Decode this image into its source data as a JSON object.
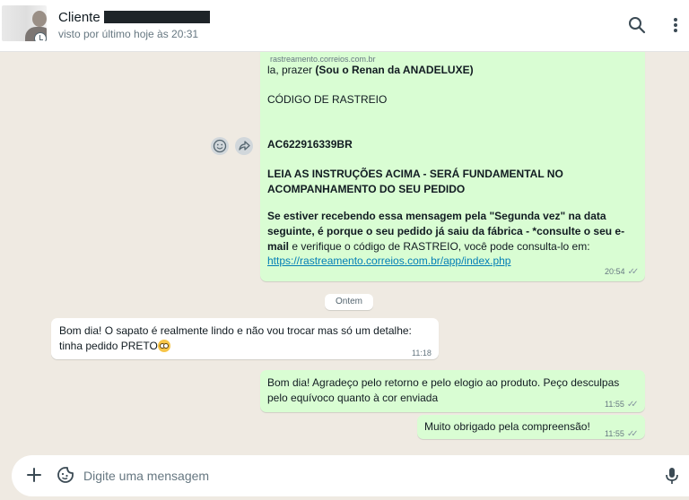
{
  "header": {
    "contact_name": "Cliente",
    "status": "visto por último hoje às 20:31"
  },
  "messages": {
    "m1": {
      "link_domain": "rastreamento.correios.com.br",
      "line1_prefix": "la, prazer ",
      "line1_bold": "(Sou o Renan da ANADELUXE)",
      "line2": "CÓDIGO DE RASTREIO",
      "tracking_code": "AC622916339BR",
      "instructions": "LEIA AS INSTRUÇÕES ACIMA - SERÁ FUNDAMENTAL NO ACOMPANHAMENTO DO SEU PEDIDO",
      "note_bold": "Se estiver recebendo essa mensagem pela \"Segunda vez\" na data seguinte, é porque o seu pedido já saiu da fábrica - *consulte o seu e-mail",
      "note_rest": " e verifique o código de RASTREIO, você pode consulta-lo em:",
      "link": "https://rastreamento.correios.com.br/app/index.php",
      "time": "20:54"
    },
    "date_chip": "Ontem",
    "m2": {
      "text": "Bom dia! O sapato é realmente lindo e não vou trocar mas só um detalhe: tinha pedido PRETO",
      "time": "11:18"
    },
    "m3": {
      "text": "Bom dia! Agradeço pelo retorno e pelo elogio ao produto. Peço desculpas pelo equívoco quanto à cor enviada",
      "time": "11:55"
    },
    "m4": {
      "text": "Muito obrigado pela compreensão!",
      "time": "11:55"
    }
  },
  "composer": {
    "placeholder": "Digite uma mensagem"
  },
  "icons": {
    "search": "search-icon",
    "menu": "kebab-menu-icon",
    "emoji": "emoji-icon",
    "forward": "forward-icon",
    "plus": "plus-icon",
    "sticker": "sticker-icon",
    "mic": "mic-icon",
    "read_ticks": "double-check-icon"
  },
  "colors": {
    "outgoing_bubble": "#d9fdd3",
    "incoming_bubble": "#ffffff",
    "chat_background": "#efeae2",
    "link": "#027eb5"
  }
}
